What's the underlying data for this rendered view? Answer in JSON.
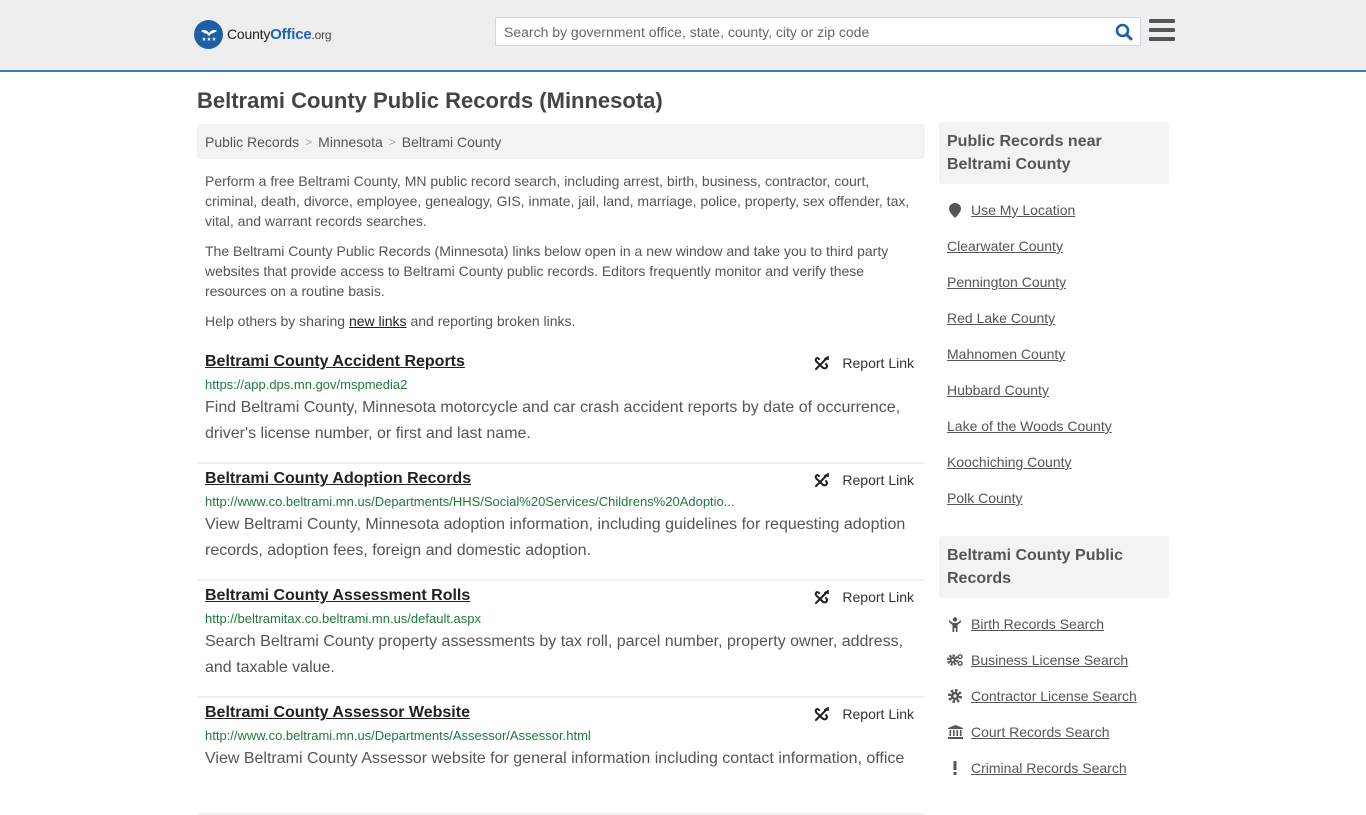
{
  "header": {
    "logo": {
      "text_main": "County",
      "text_brand": "Office",
      "text_tld": ".org"
    },
    "search": {
      "placeholder": "Search by government office, state, county, city or zip code",
      "value": ""
    },
    "search_icon": "search-icon",
    "menu_icon": "hamburger-menu-icon"
  },
  "page": {
    "title": "Beltrami County Public Records (Minnesota)"
  },
  "breadcrumb": [
    {
      "label": "Public Records"
    },
    {
      "label": "Minnesota"
    },
    {
      "label": "Beltrami County"
    }
  ],
  "breadcrumb_separator": ">",
  "intro": {
    "p1": "Perform a free Beltrami County, MN public record search, including arrest, birth, business, contractor, court, criminal, death, divorce, employee, genealogy, GIS, inmate, jail, land, marriage, police, property, sex offender, tax, vital, and warrant records searches.",
    "p2": "The Beltrami County Public Records (Minnesota) links below open in a new window and take you to third party websites that provide access to Beltrami County public records. Editors frequently monitor and verify these resources on a routine basis.",
    "p3_before": "Help others by sharing ",
    "p3_link": "new links",
    "p3_after": " and reporting broken links."
  },
  "report_label": "Report Link",
  "records": [
    {
      "title": "Beltrami County Accident Reports",
      "url": "https://app.dps.mn.gov/mspmedia2",
      "description": "Find Beltrami County, Minnesota motorcycle and car crash accident reports by date of occurrence, driver's license number, or first and last name."
    },
    {
      "title": "Beltrami County Adoption Records",
      "url": "http://www.co.beltrami.mn.us/Departments/HHS/Social%20Services/Childrens%20Adoptio...",
      "description": "View Beltrami County, Minnesota adoption information, including guidelines for requesting adoption records, adoption fees, foreign and domestic adoption."
    },
    {
      "title": "Beltrami County Assessment Rolls",
      "url": "http://beltramitax.co.beltrami.mn.us/default.aspx",
      "description": "Search Beltrami County property assessments by tax roll, parcel number, property owner, address, and taxable value."
    },
    {
      "title": "Beltrami County Assessor Website",
      "url": "http://www.co.beltrami.mn.us/Departments/Assessor/Assessor.html",
      "description": "View Beltrami County Assessor website for general information including contact information, office"
    }
  ],
  "sidebar": {
    "nearby": {
      "heading": "Public Records near Beltrami County",
      "use_location": "Use My Location",
      "counties": [
        "Clearwater County",
        "Pennington County",
        "Red Lake County",
        "Mahnomen County",
        "Hubbard County",
        "Lake of the Woods County",
        "Koochiching County",
        "Polk County"
      ]
    },
    "county_records": {
      "heading": "Beltrami County Public Records",
      "items": [
        {
          "label": "Birth Records Search",
          "icon": "child-icon"
        },
        {
          "label": "Business License Search",
          "icon": "gears-icon"
        },
        {
          "label": "Contractor License Search",
          "icon": "gear-icon"
        },
        {
          "label": "Court Records Search",
          "icon": "courthouse-icon"
        },
        {
          "label": "Criminal Records Search",
          "icon": "exclamation-icon"
        }
      ]
    }
  },
  "colors": {
    "brand_blue": "#1f5fa8",
    "header_border": "#3a7bb0",
    "url_green": "#1e7a3a"
  }
}
